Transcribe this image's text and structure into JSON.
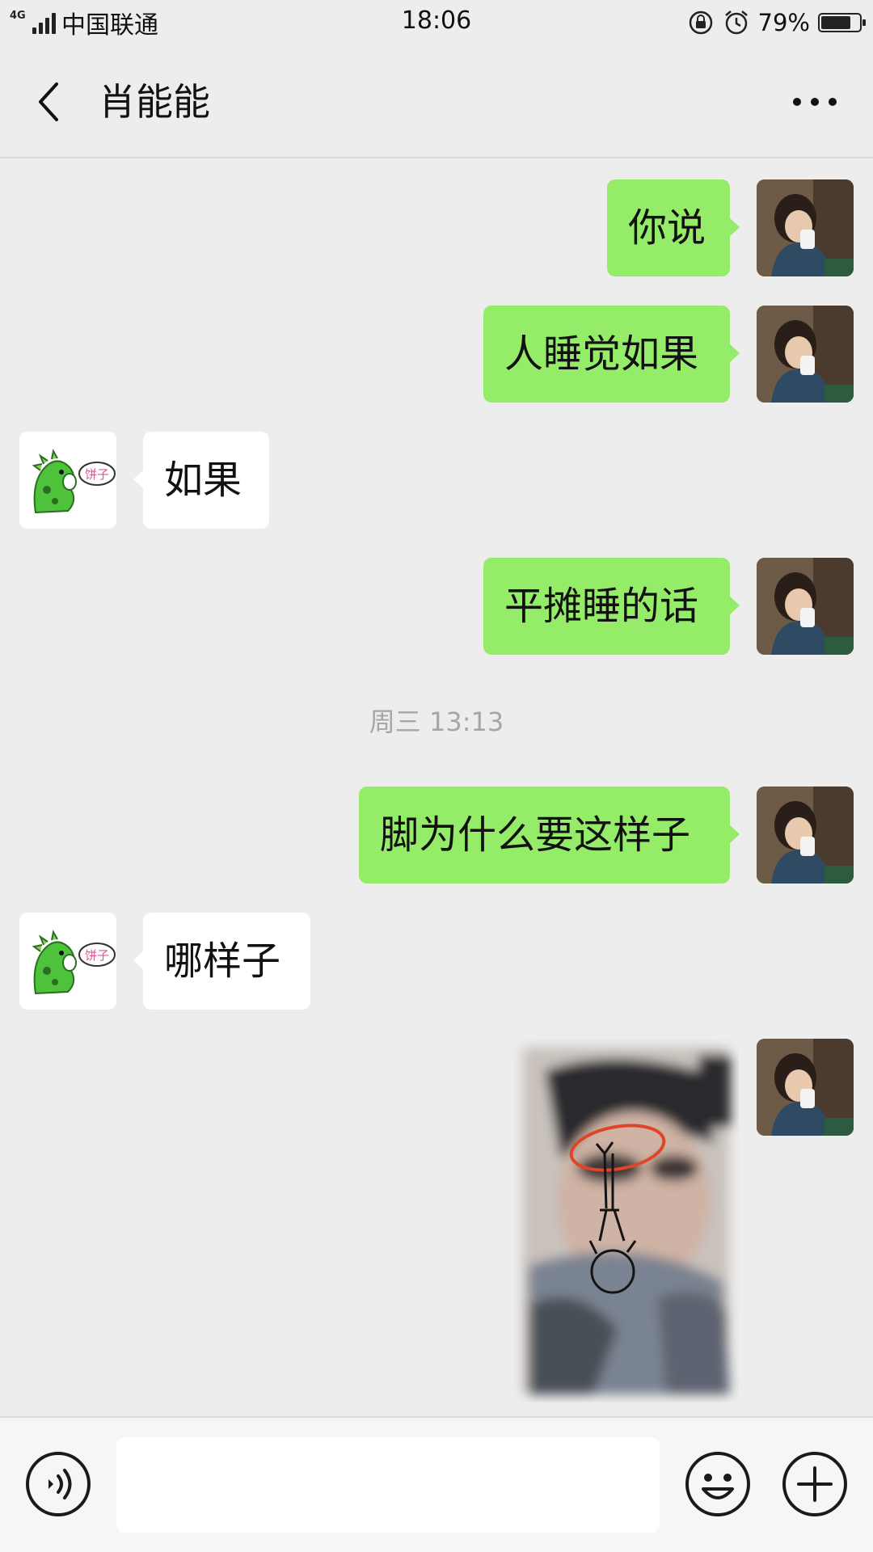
{
  "status_bar": {
    "network": "4G",
    "carrier": "中国联通",
    "time": "18:06",
    "battery_percent_text": "79%",
    "battery_level": 0.79,
    "icons": [
      "signal-icon",
      "rotation-lock-icon",
      "alarm-icon",
      "battery-icon"
    ]
  },
  "header": {
    "title": "肖能能",
    "back_icon": "chevron-left-icon",
    "more_icon": "more-dots-icon"
  },
  "messages": [
    {
      "side": "out",
      "text": "你说"
    },
    {
      "side": "out",
      "text": "人睡觉如果"
    },
    {
      "side": "in",
      "text": "如果"
    },
    {
      "side": "out",
      "text": "平摊睡的话"
    },
    {
      "side": "divider",
      "text": "周三 13:13"
    },
    {
      "side": "out",
      "text": "脚为什么要这样子"
    },
    {
      "side": "in",
      "text": "哪样子"
    },
    {
      "side": "out",
      "type": "image"
    }
  ],
  "sticker_text": "饼子",
  "input_bar": {
    "value": "",
    "icons": [
      "voice-icon",
      "emoji-icon",
      "plus-icon"
    ]
  },
  "colors": {
    "background": "#ededed",
    "bubble_out": "#95ec69",
    "bubble_in": "#ffffff",
    "divider_text": "#a6a6a6"
  }
}
